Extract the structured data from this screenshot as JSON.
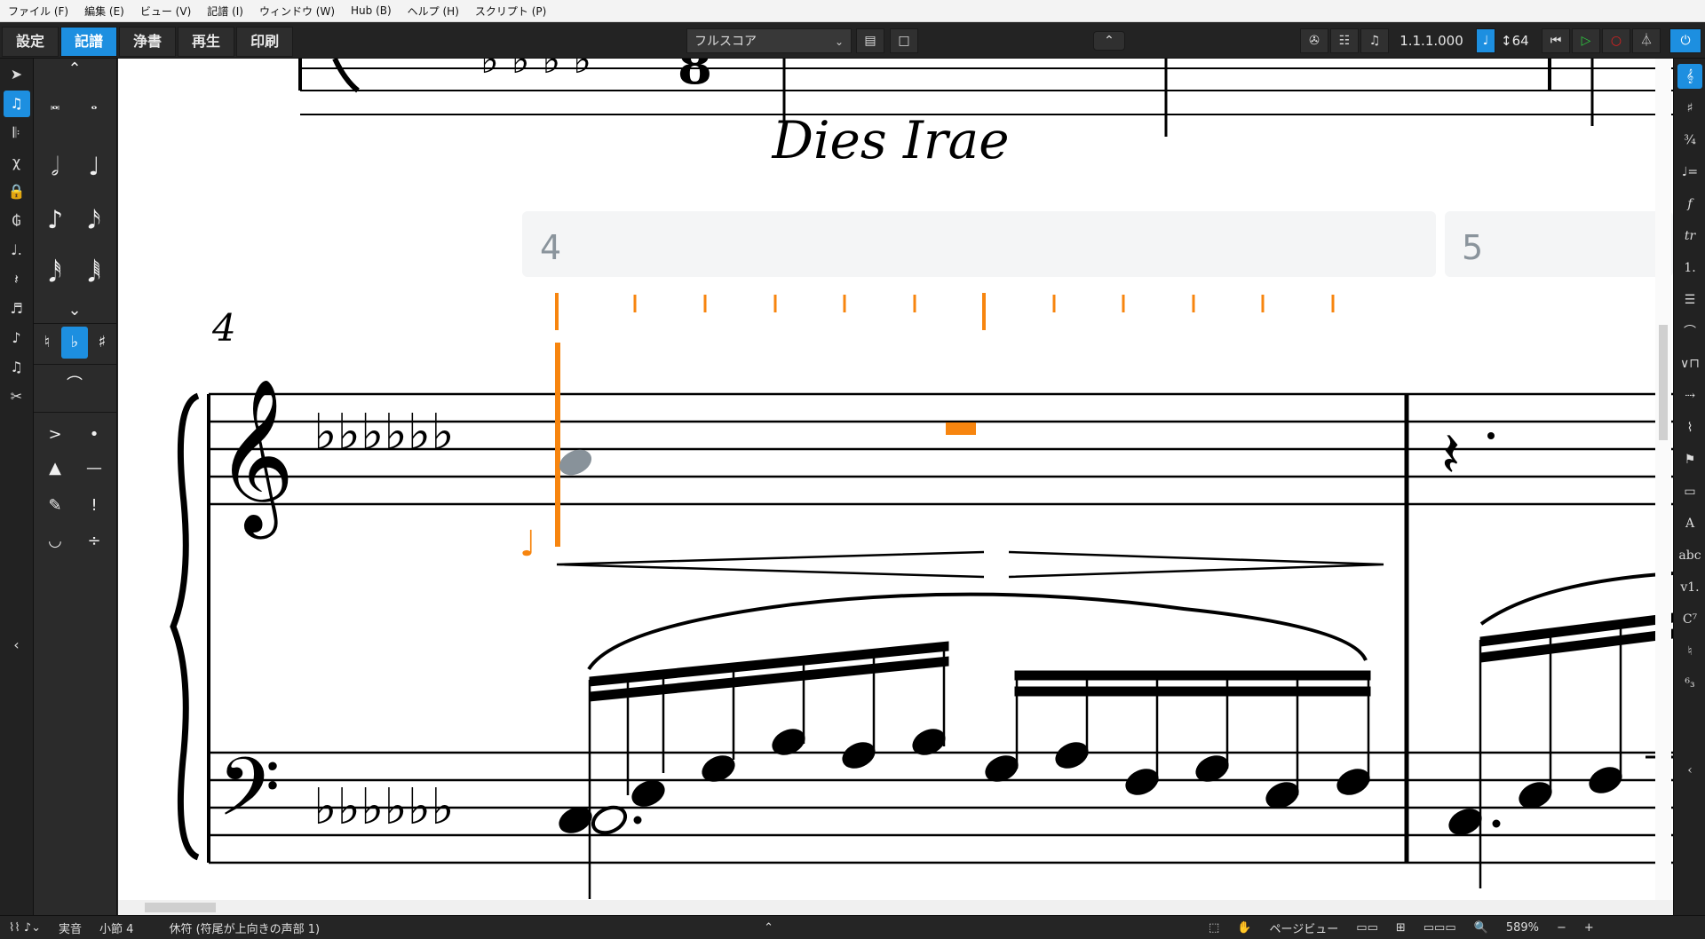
{
  "menu": [
    "ファイル (F)",
    "編集 (E)",
    "ビュー (V)",
    "記譜 (I)",
    "ウィンドウ (W)",
    "Hub (B)",
    "ヘルプ (H)",
    "スクリプト (P)"
  ],
  "modes": [
    "設定",
    "記譜",
    "浄書",
    "再生",
    "印刷"
  ],
  "active_mode": "記譜",
  "layout": {
    "selected": "フルスコア"
  },
  "transport": {
    "position": "1.1.1.000",
    "tempo": "64"
  },
  "score": {
    "title": "Dies Irae",
    "bar_number": "4",
    "ruler_bars": [
      "4",
      "5"
    ]
  },
  "status": {
    "pitch_mode": "実音",
    "bar": "小節 4",
    "selection": "休符 (符尾が上向きの声部 1)",
    "view": "ページビュー",
    "zoom": "589%"
  },
  "colors": {
    "accent": "#1d8fe0",
    "caret": "#f7850f",
    "panel": "#232323",
    "ruler": "#f4f5f6",
    "ruler_text": "#8a949c"
  }
}
